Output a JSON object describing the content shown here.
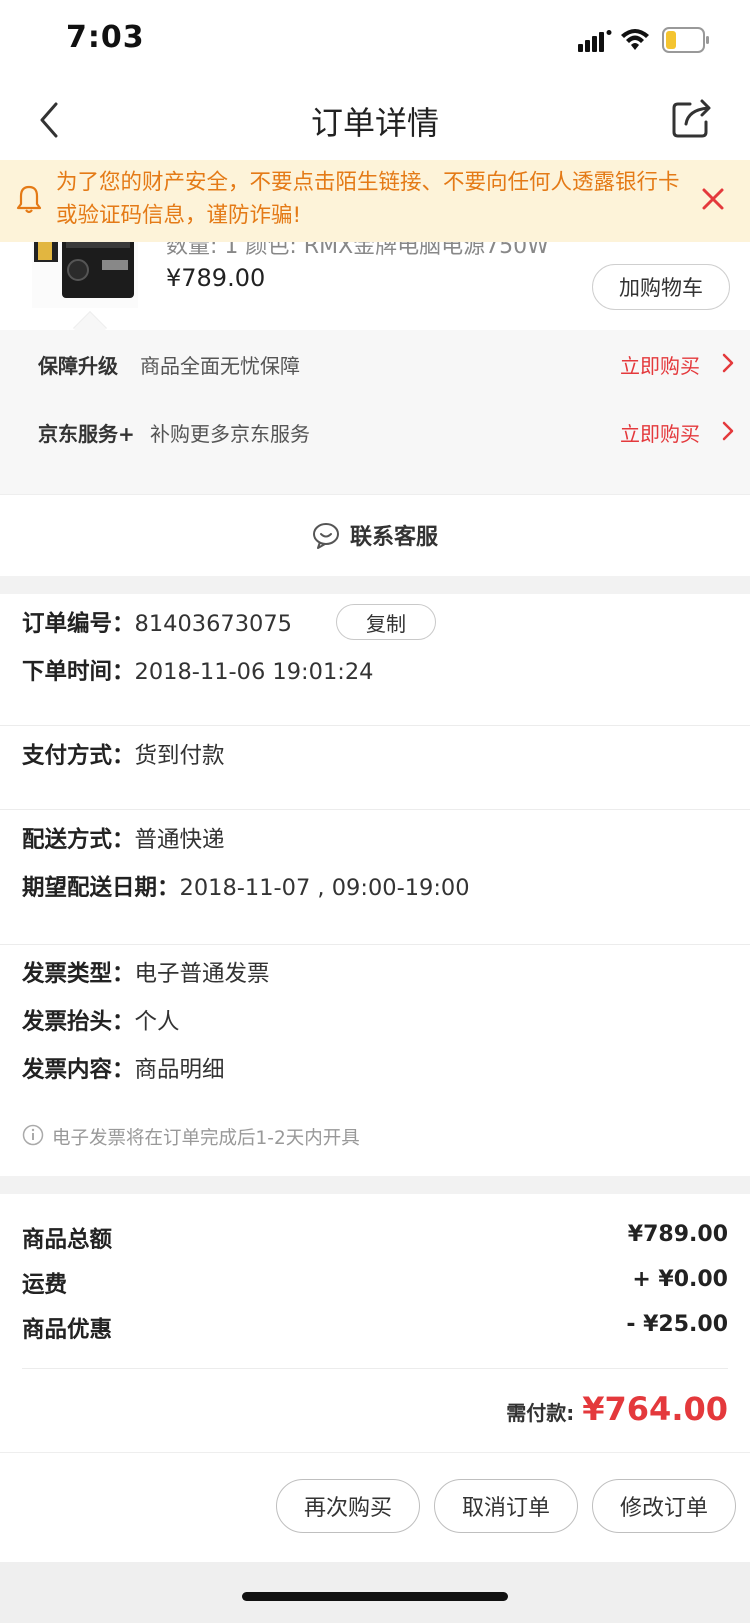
{
  "status_bar": {
    "time": "7:03"
  },
  "nav": {
    "title": "订单详情"
  },
  "notice": {
    "text": "为了您的财产安全，不要点击陌生链接、不要向任何人透露银行卡或验证码信息，谨防诈骗!"
  },
  "product": {
    "subtitle": "数量: 1 颜色: RMX金牌电脑电源750W",
    "price": "¥789.00",
    "add_cart": "加购物车"
  },
  "services": [
    {
      "label": "保障升级",
      "desc": "商品全面无忧保障",
      "action": "立即购买"
    },
    {
      "label": "京东服务+",
      "desc": "补购更多京东服务",
      "action": "立即购买"
    }
  ],
  "contact": {
    "label": "联系客服"
  },
  "order": {
    "number_label": "订单编号：",
    "number": "81403673075",
    "copy": "复制",
    "time_label": "下单时间：",
    "time": "2018-11-06 19:01:24",
    "pay_label": "支付方式：",
    "pay": "货到付款",
    "ship_label": "配送方式：",
    "ship": "普通快递",
    "expect_label": "期望配送日期：",
    "expect": "2018-11-07 , 09:00-19:00",
    "inv_type_label": "发票类型：",
    "inv_type": "电子普通发票",
    "inv_title_label": "发票抬头：",
    "inv_title": "个人",
    "inv_content_label": "发票内容：",
    "inv_content": "商品明细",
    "tip": "电子发票将在订单完成后1-2天内开具"
  },
  "totals": {
    "goods_label": "商品总额",
    "goods": "¥789.00",
    "freight_label": "运费",
    "freight": "+ ¥0.00",
    "discount_label": "商品优惠",
    "discount": "- ¥25.00",
    "pay_label": "需付款:",
    "pay": "¥764.00"
  },
  "actions": {
    "rebuy": "再次购买",
    "cancel": "取消订单",
    "modify": "修改订单"
  }
}
